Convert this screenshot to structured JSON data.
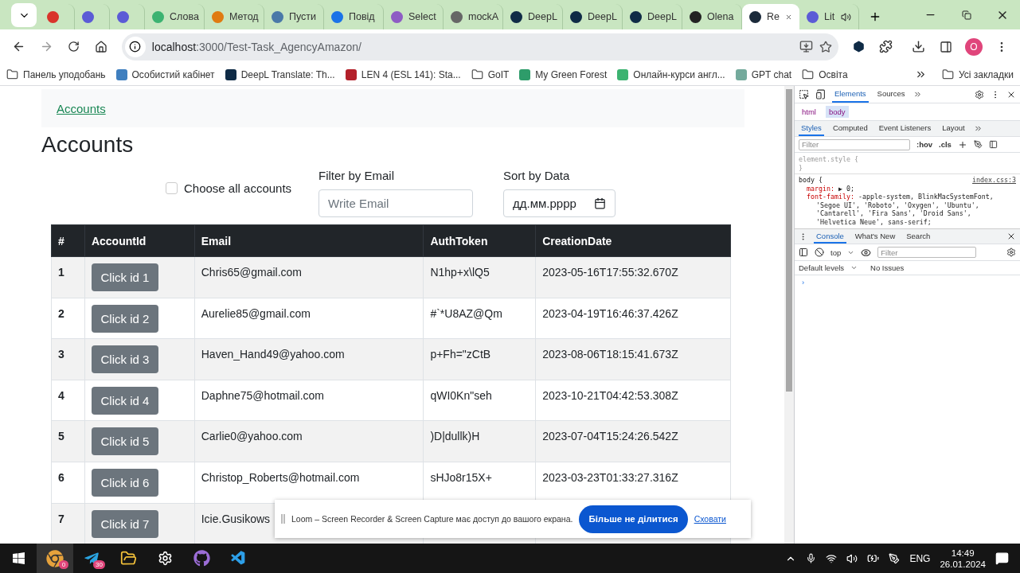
{
  "browser": {
    "tabs": [
      {
        "color": "#d9342b",
        "selected": false,
        "playing": false
      },
      {
        "color": "#5b5bd6",
        "selected": false,
        "playing": false
      },
      {
        "color": "#5b5bd6",
        "selected": false,
        "playing": false
      },
      {
        "label": "Слова",
        "color": "#3cb371",
        "selected": false,
        "playing": false
      },
      {
        "label": "Метод",
        "color": "#e07b12",
        "selected": false,
        "playing": false
      },
      {
        "label": "Пусти",
        "color": "#4a79a8",
        "selected": false,
        "playing": false
      },
      {
        "label": "Повід",
        "color": "#1a73e8",
        "selected": false,
        "playing": false
      },
      {
        "label": "Select",
        "color": "#8e5cc4",
        "selected": false,
        "playing": false
      },
      {
        "label": "mockA",
        "color": "#666666",
        "selected": false,
        "playing": false
      },
      {
        "label": "DeepL",
        "color": "#0f2b46",
        "selected": false,
        "playing": false
      },
      {
        "label": "DeepL",
        "color": "#0f2b46",
        "selected": false,
        "playing": false
      },
      {
        "label": "DeepL",
        "color": "#0f2b46",
        "selected": false,
        "playing": false
      },
      {
        "label": "Olena",
        "color": "#222222",
        "selected": false,
        "playing": false
      },
      {
        "label": "Re",
        "color": "#1b2a3a",
        "selected": true,
        "playing": false
      },
      {
        "label": "Lit",
        "color": "#5b5bd6",
        "selected": false,
        "playing": true
      }
    ],
    "address": {
      "host": "localhost",
      "path": ":3000/Test-Task_AgencyAmazon/"
    },
    "profile": "O",
    "bookmarks": [
      {
        "kind": "folder",
        "label": "Панель уподобань"
      },
      {
        "kind": "site",
        "label": "Особистий кабінет",
        "color": "#3f7fbf"
      },
      {
        "kind": "site",
        "label": "DeepL Translate: Th...",
        "color": "#0f2b46"
      },
      {
        "kind": "site",
        "label": "LEN 4 (ESL 141): Sta...",
        "color": "#b3202a"
      },
      {
        "kind": "folder",
        "label": "GoIT"
      },
      {
        "kind": "site",
        "label": "My Green Forest",
        "color": "#2e9c6a"
      },
      {
        "kind": "site",
        "label": "Онлайн-курси англ...",
        "color": "#3cb371"
      },
      {
        "kind": "site",
        "label": "GPT chat",
        "color": "#74aa9c"
      },
      {
        "kind": "folder",
        "label": "Освіта"
      }
    ],
    "all_bookmarks": "Усі закладки"
  },
  "page": {
    "breadcrumb": "Accounts",
    "heading": "Accounts",
    "choose_all": {
      "label": "Choose all accounts",
      "checked": false
    },
    "email_filter": {
      "label": "Filter by Email",
      "placeholder": "Write Email"
    },
    "date_sort": {
      "label": "Sort by Data",
      "value": "дд.мм.рррр"
    },
    "table": {
      "columns": [
        "#",
        "AccountId",
        "Email",
        "AuthToken",
        "CreationDate"
      ],
      "rows": [
        {
          "n": "1",
          "button": "Click id 1",
          "email": "Chris65@gmail.com",
          "token": "N1hp+x\\lQ5",
          "date": "2023-05-16T17:55:32.670Z"
        },
        {
          "n": "2",
          "button": "Click id 2",
          "email": "Aurelie85@gmail.com",
          "token": "#`*U8AZ@Qm",
          "date": "2023-04-19T16:46:37.426Z"
        },
        {
          "n": "3",
          "button": "Click id 3",
          "email": "Haven_Hand49@yahoo.com",
          "token": "p+Fh=\"zCtB",
          "date": "2023-08-06T18:15:41.673Z"
        },
        {
          "n": "4",
          "button": "Click id 4",
          "email": "Daphne75@hotmail.com",
          "token": "qWI0Kn\"seh",
          "date": "2023-10-21T04:42:53.308Z"
        },
        {
          "n": "5",
          "button": "Click id 5",
          "email": "Carlie0@yahoo.com",
          "token": ")D|dullk)H",
          "date": "2023-07-04T15:24:26.542Z"
        },
        {
          "n": "6",
          "button": "Click id 6",
          "email": "Christop_Roberts@hotmail.com",
          "token": "sHJo8r15X+",
          "date": "2023-03-23T01:33:27.316Z"
        },
        {
          "n": "7",
          "button": "Click id 7",
          "email": "Icie.Gusikows"
        }
      ]
    }
  },
  "loom_bar": {
    "message": "Loom – Screen Recorder & Screen Capture має доступ до вашого екрана.",
    "button": "Більше не ділитися",
    "link": "Сховати"
  },
  "devtools": {
    "tabs": [
      {
        "label": "Elements",
        "selected": true
      },
      {
        "label": "Sources",
        "selected": false
      }
    ],
    "breadcrumb": [
      {
        "label": "html",
        "selected": false
      },
      {
        "label": "body",
        "selected": true
      }
    ],
    "subtabs": [
      {
        "label": "Styles",
        "selected": true
      },
      {
        "label": "Computed",
        "selected": false
      },
      {
        "label": "Event Listeners",
        "selected": false
      },
      {
        "label": "Layout",
        "selected": false
      }
    ],
    "filter_placeholder": "Filter",
    "hov": ":hov",
    "cls": ".cls",
    "rules": [
      {
        "selector": "element.style {",
        "faded": true,
        "close": "}"
      },
      {
        "selector": "body {",
        "faded": false,
        "source": "index.css:3",
        "declarations": [
          {
            "property": "margin:",
            "value": "▶ 0;"
          },
          {
            "property": "font-family:",
            "value": "-apple-system, BlinkMacSystemFont,"
          }
        ],
        "continuation": [
          "'Segoe UI', 'Roboto', 'Oxygen', 'Ubuntu',",
          "'Cantarell', 'Fira Sans', 'Droid Sans',",
          "'Helvetica Neue', sans-serif;"
        ]
      }
    ],
    "drawer_tabs": [
      {
        "label": "Console",
        "selected": true
      },
      {
        "label": "What's New",
        "selected": false
      },
      {
        "label": "Search",
        "selected": false
      }
    ],
    "context": "top",
    "console_filter": "Filter",
    "levels": "Default levels",
    "issues": "No Issues",
    "prompt": "›"
  },
  "taskbar": {
    "chrome_badge": "0",
    "telegram_badge": "30",
    "language": "ENG",
    "time": "14:49",
    "date": "26.01.2024"
  }
}
